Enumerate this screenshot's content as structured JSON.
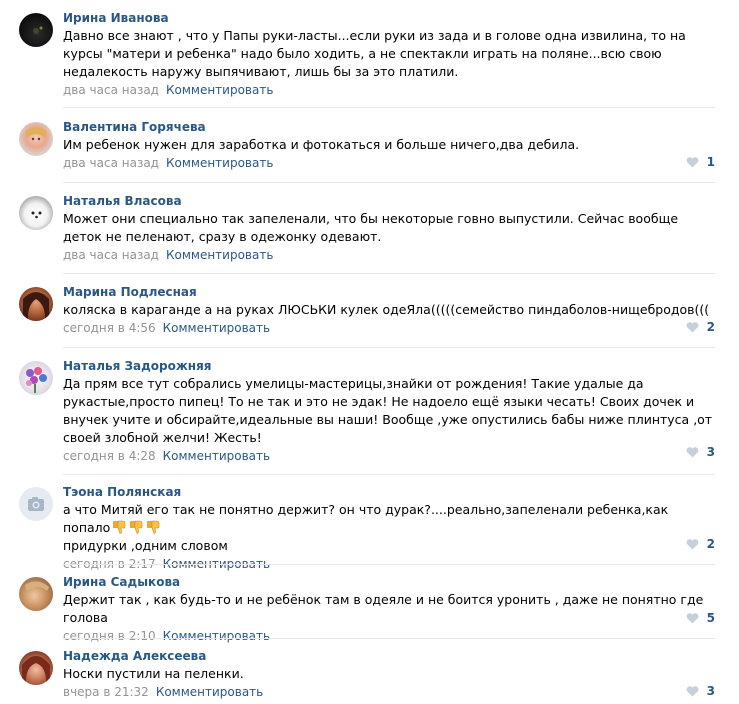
{
  "comments": [
    {
      "author": "Ирина Иванова",
      "text": "Давно все знают , что у Папы руки-ласты...если руки из зада и в голове одна извилина, то на курсы \"матери и ребенка\" надо было ходить, а не спектакли играть на поляне...всю свою недалекость наружу выпячивают, лишь бы за это платили.",
      "time": "два часа назад",
      "reply": "Комментировать",
      "likes": ""
    },
    {
      "author": "Валентина Горячева",
      "text": "Им ребенок нужен для заработка и фотокаться и больше ничего,два дебила.",
      "time": "два часа назад",
      "reply": "Комментировать",
      "likes": "1"
    },
    {
      "author": "Наталья Власова",
      "text": "Может они специально так запеленали, что бы некоторые говно выпустили. Сейчас вообще деток не пеленают, сразу в одежонку одевают.",
      "time": "два часа назад",
      "reply": "Комментировать",
      "likes": ""
    },
    {
      "author": "Марина Подлесная",
      "text": "коляска в караганде а на руках ЛЮСЬКИ кулек одеЯла(((((семейство пиндаболов-нищебродов(((",
      "time": "сегодня в 4:56",
      "reply": "Комментировать",
      "likes": "2"
    },
    {
      "author": "Наталья Задорожняя",
      "text": "Да прям все тут собрались умелицы-мастерицы,знайки от рождения! Такие удалые да рукастые,просто пипец! То не так и это не эдак! Не надоело ещё языки чесать! Своих дочек и внучек учите и обсирайте,идеальные вы наши! Вообще ,уже опустились бабы ниже плинтуса ,от своей злобной желчи! Жесть!",
      "time": "сегодня в 4:28",
      "reply": "Комментировать",
      "likes": "3"
    },
    {
      "author": "Тэона Полянская",
      "text": "а что Митяй его так не понятно держит? он что дурак?....реально,запеленали ребенка,как попало",
      "text2": "придурки ,одним словом",
      "emoji": [
        "thumbs-down-emoji",
        "thumbs-down-emoji",
        "thumbs-down-emoji"
      ],
      "time": "сегодня в 2:17",
      "reply": "Комментировать",
      "likes": "2"
    },
    {
      "author": "Ирина Садыкова",
      "text": "Держит так , как будь-то и не ребёнок там в одеяле и не боится уронить , даже не понятно где голова",
      "time": "сегодня в 2:10",
      "reply": "Комментировать",
      "likes": "5"
    },
    {
      "author": "Надежда Алексеева",
      "text": "Носки пустили на пеленки.",
      "time": "вчера в 21:32",
      "reply": "Комментировать",
      "likes": "3"
    }
  ],
  "colors": {
    "link": "#2a5885",
    "meta": "#939393",
    "heart": "#c5d0db",
    "separator": "#e7e8ec"
  }
}
